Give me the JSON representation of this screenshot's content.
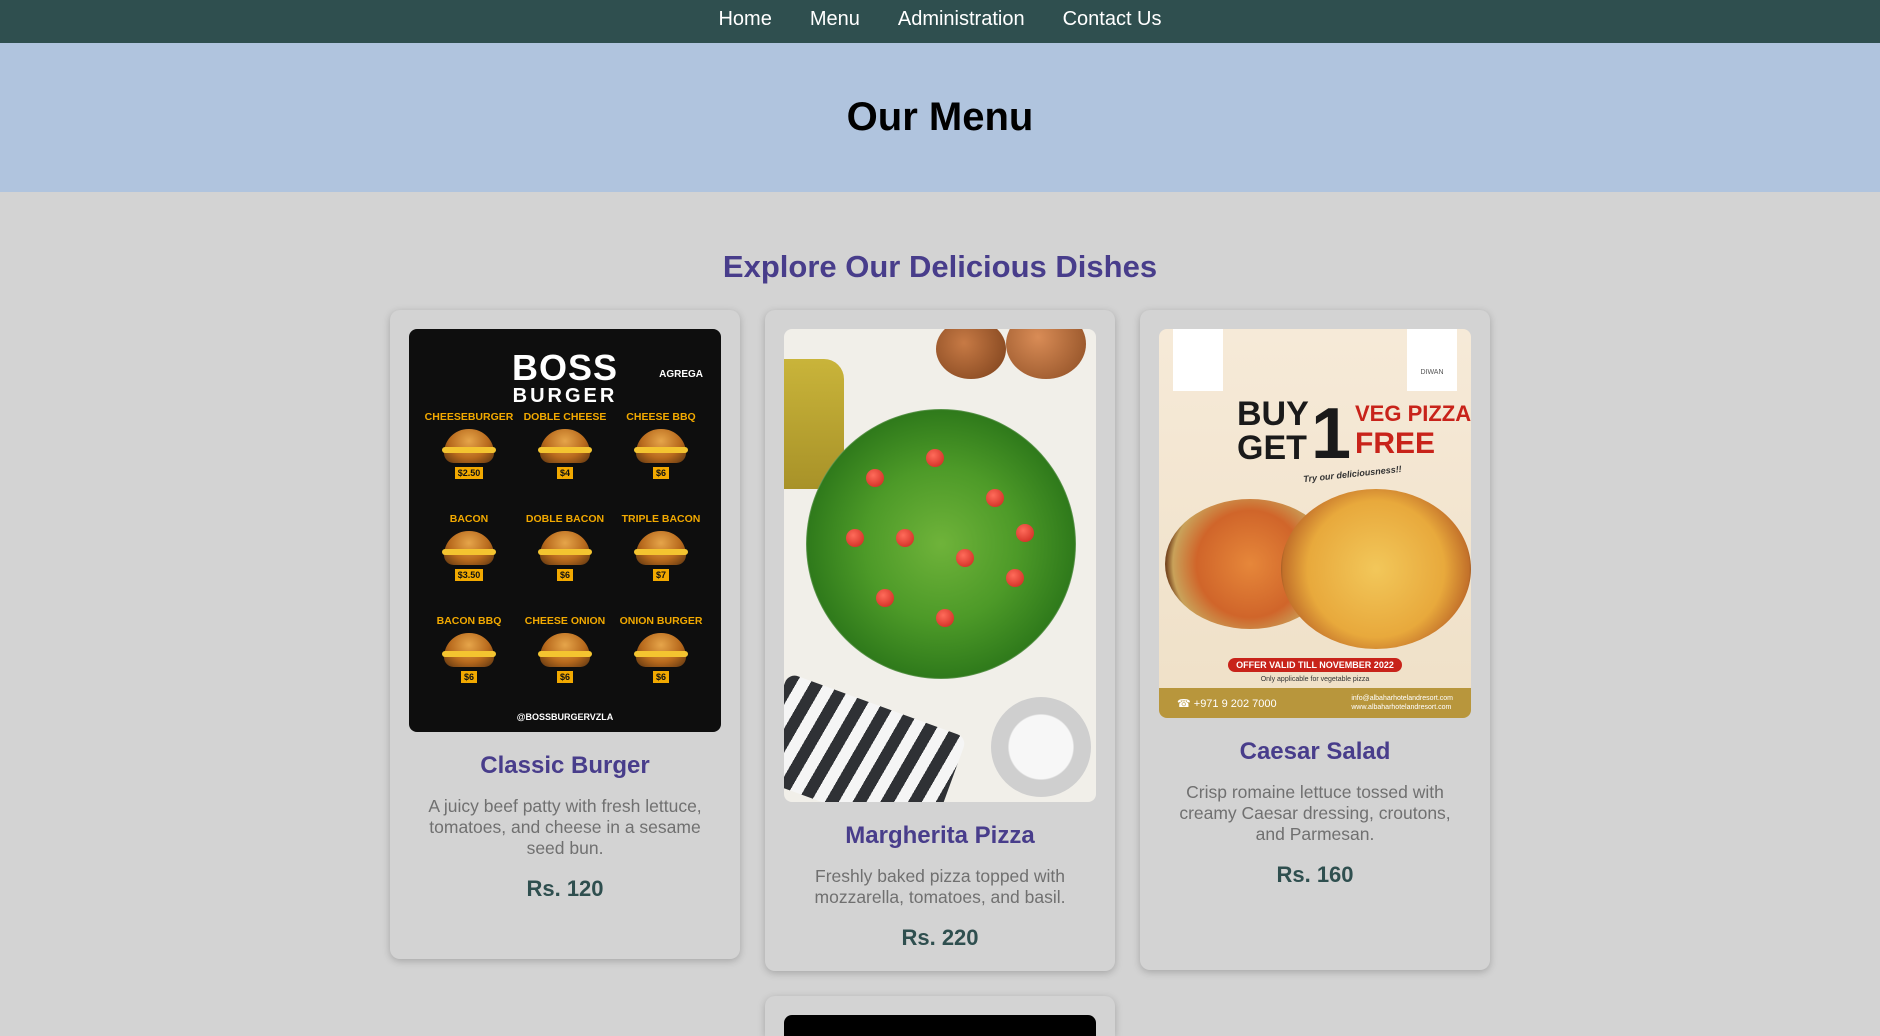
{
  "nav": {
    "items": [
      {
        "label": "Home"
      },
      {
        "label": "Menu"
      },
      {
        "label": "Administration"
      },
      {
        "label": "Contact Us"
      }
    ]
  },
  "hero": {
    "title": "Our Menu"
  },
  "section": {
    "title": "Explore Our Delicious Dishes"
  },
  "colors": {
    "nav_bg": "#2f4f4f",
    "hero_bg": "#b0c4de",
    "page_bg": "#d3d3d3",
    "accent": "#483d8b",
    "price": "#2f4f4f"
  },
  "dishes": [
    {
      "name": "Classic Burger",
      "description": "A juicy beef patty with fresh lettuce, tomatoes, and cheese in a sesame seed bun.",
      "price": "Rs. 120",
      "image": {
        "brand_top": "BOSS",
        "brand_bottom": "BURGER",
        "badge": "AGREGA",
        "items": [
          {
            "name": "CHEESEBURGER",
            "price": "$2.50"
          },
          {
            "name": "DOBLE CHEESE",
            "price": "$4"
          },
          {
            "name": "CHEESE BBQ",
            "price": "$6"
          },
          {
            "name": "BACON",
            "price": "$3.50"
          },
          {
            "name": "DOBLE BACON",
            "price": "$6"
          },
          {
            "name": "TRIPLE BACON",
            "price": "$7"
          },
          {
            "name": "BACON BBQ",
            "price": "$6"
          },
          {
            "name": "CHEESE ONION",
            "price": "$6"
          },
          {
            "name": "ONION BURGER",
            "price": "$6"
          }
        ],
        "handle": "@BOSSBURGERVZLA"
      }
    },
    {
      "name": "Margherita Pizza",
      "description": "Freshly baked pizza topped with mozzarella, tomatoes, and basil.",
      "price": "Rs. 220"
    },
    {
      "name": "Caesar Salad",
      "description": "Crisp romaine lettuce tossed with creamy Caesar dressing, croutons, and Parmesan.",
      "price": "Rs. 160",
      "image": {
        "buy": "BUY",
        "one": "1",
        "get": "GET",
        "veg": "VEG PIZZA",
        "free": "FREE",
        "tagline": "Try our deliciousness!!",
        "right_logo": "DIWAN",
        "offer": "OFFER VALID TILL NOVEMBER 2022",
        "offer_note": "Only applicable for vegetable pizza",
        "phone": "+971 9 202 7000",
        "email": "info@albaharhotelandresort.com",
        "web": "www.albaharhotelandresort.com"
      }
    }
  ]
}
